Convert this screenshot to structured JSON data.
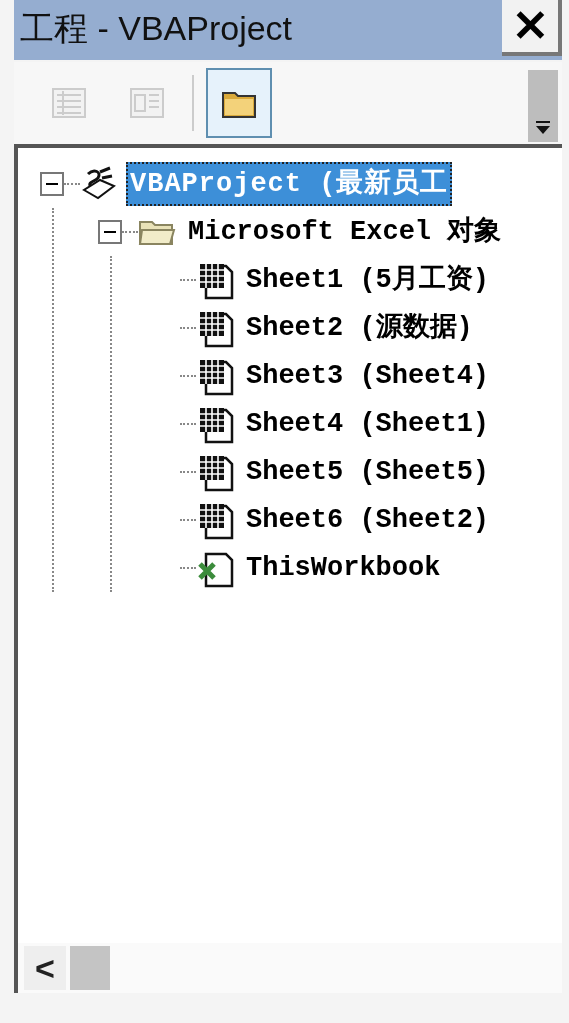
{
  "window": {
    "title": "工程 - VBAProject",
    "close": "✕"
  },
  "toolbar": [
    {
      "kind": "view-code",
      "disabled": true,
      "pressed": false
    },
    {
      "kind": "view-object",
      "disabled": true,
      "pressed": false
    },
    {
      "kind": "toggle-folders",
      "disabled": false,
      "pressed": true
    }
  ],
  "tree": [
    {
      "kind": "project",
      "label": "VBAProject (最新员工",
      "selected": true,
      "expanded": true,
      "children": [
        {
          "kind": "folder",
          "label": "Microsoft Excel 对象",
          "selected": false,
          "expanded": true,
          "children": [
            {
              "kind": "sheet",
              "label": "Sheet1 (5月工资)",
              "selected": false
            },
            {
              "kind": "sheet",
              "label": "Sheet2 (源数据)",
              "selected": false
            },
            {
              "kind": "sheet",
              "label": "Sheet3 (Sheet4)",
              "selected": false
            },
            {
              "kind": "sheet",
              "label": "Sheet4 (Sheet1)",
              "selected": false
            },
            {
              "kind": "sheet",
              "label": "Sheet5 (Sheet5)",
              "selected": false
            },
            {
              "kind": "sheet",
              "label": "Sheet6 (Sheet2)",
              "selected": false
            },
            {
              "kind": "workbook",
              "label": "ThisWorkbook",
              "selected": false
            }
          ]
        }
      ]
    }
  ],
  "scrollbar": {
    "left_arrow": "<"
  }
}
